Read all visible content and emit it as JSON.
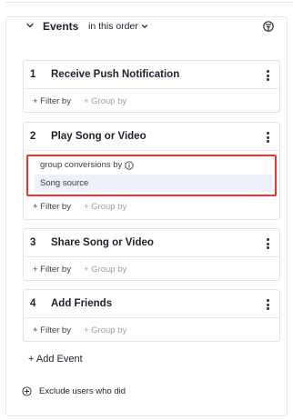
{
  "panel": {
    "title": "Events",
    "order_label": "in this order"
  },
  "events": [
    {
      "number": "1",
      "title": "Receive Push Notification",
      "filter_label": "+ Filter by",
      "group_label": "+ Group by"
    },
    {
      "number": "2",
      "title": "Play Song or Video",
      "filter_label": "+ Filter by",
      "group_label": "+ Group by",
      "group_conversions": {
        "label": "group conversions by",
        "value": "Song source"
      }
    },
    {
      "number": "3",
      "title": "Share Song or Video",
      "filter_label": "+ Filter by",
      "group_label": "+ Group by"
    },
    {
      "number": "4",
      "title": "Add Friends",
      "filter_label": "+ Filter by",
      "group_label": "+ Group by"
    }
  ],
  "add_event_label": "+ Add Event",
  "exclude_label": "Exclude users who did",
  "icons": {
    "collapse": "chevron-down-icon",
    "order_dropdown": "chevron-down-icon",
    "header": "funnel-settings-icon",
    "card_menu": "kebab-menu-icon",
    "info": "info-icon",
    "exclude": "plus-circle-icon"
  },
  "colors": {
    "highlight_border": "#ee3333",
    "chip_background": "#eef1f8"
  }
}
